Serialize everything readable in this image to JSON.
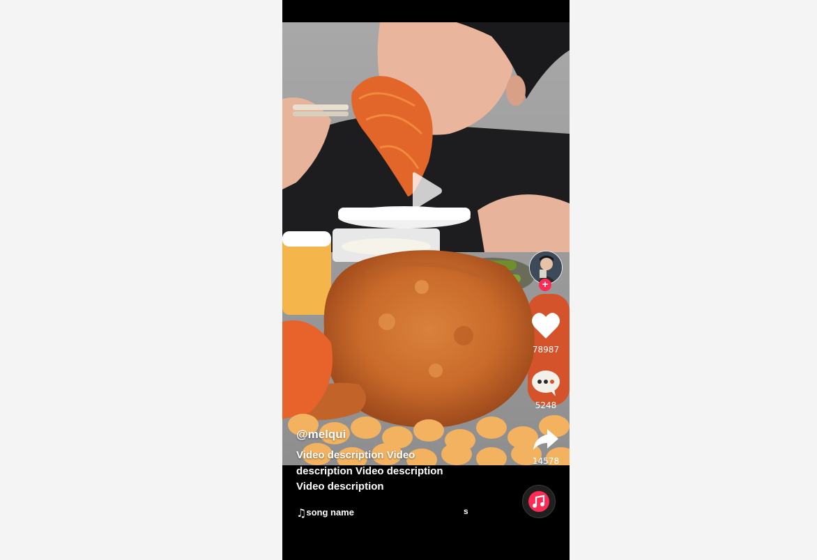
{
  "video": {
    "username": "@melqui",
    "description": "Video description Video description Video description Video description",
    "song_name": "song name",
    "marquee_tail": "s"
  },
  "actions": {
    "likes": "78987",
    "comments": "5248",
    "shares": "14578"
  },
  "follow_badge": "+",
  "icons": {
    "play": "play-icon",
    "like": "heart-icon",
    "comment": "comment-dots-icon",
    "share": "share-arrow-icon",
    "note": "music-note-icon",
    "disc": "music-disc-icon"
  },
  "colors": {
    "accent": "#fe2c55",
    "page_background": "#f4f4f4",
    "player_background": "#000000"
  }
}
